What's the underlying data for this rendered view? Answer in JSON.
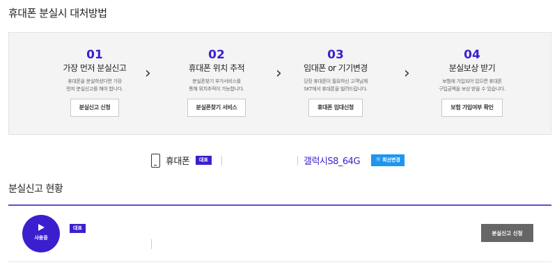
{
  "page": {
    "title": "휴대폰 분실시 대처방법"
  },
  "steps": [
    {
      "number": "01",
      "title": "가장 먼저 분실신고",
      "desc_line1": "휴대폰을 분실하셨다면 가장",
      "desc_line2": "먼저 분실신고를 해야 합니다.",
      "button": "분실신고 신청"
    },
    {
      "number": "02",
      "title": "휴대폰 위치 추적",
      "desc_line1": "분실폰찾기 부가서비스를",
      "desc_line2": "통해 위치추적이 가능합니다.",
      "button": "분실폰찾기 서비스"
    },
    {
      "number": "03",
      "title": "임대폰 or 기기변경",
      "desc_line1": "당장 휴대폰이 필요하신 고객님께",
      "desc_line2": "SKT에서 휴대폰을 빌려드립니다.",
      "button": "휴대폰 임대신청"
    },
    {
      "number": "04",
      "title": "분실보상 받기",
      "desc_line1": "보험에 가입되어 있으면 휴대폰",
      "desc_line2": "구입금액을 보상 받을 수 있습니다.",
      "button": "보험 가입여부 확인"
    }
  ],
  "arrow_glyph": "›",
  "device": {
    "icon": "phone-icon",
    "label": "휴대폰",
    "badge": "대표",
    "model": "갤럭시S8_64G",
    "change_button": "회선변경",
    "change_icon": "gear-icon"
  },
  "report_status": {
    "title": "분실신고 현황",
    "status": "사용중",
    "badge": "대표",
    "button": "분실신고 신청"
  },
  "colors": {
    "accent": "#3b1fcf",
    "change_button": "#1e96f0",
    "report_button": "#666666"
  }
}
